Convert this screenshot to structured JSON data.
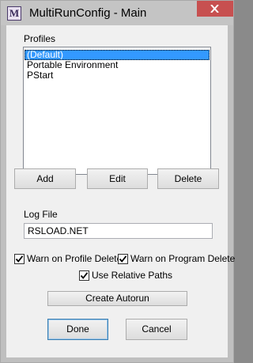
{
  "window": {
    "title": "MultiRunConfig - Main",
    "app_icon_glyph": "M"
  },
  "profiles": {
    "label": "Profiles",
    "items": [
      "(Default)",
      "Portable Environment",
      "PStart"
    ],
    "selected_index": 0
  },
  "buttons": {
    "add": "Add",
    "edit": "Edit",
    "delete": "Delete",
    "create_autorun": "Create Autorun",
    "done": "Done",
    "cancel": "Cancel"
  },
  "log_file": {
    "label": "Log File",
    "value": "RSLOAD.NET"
  },
  "options": {
    "warn_profile_delete": {
      "label": "Warn on Profile Delete",
      "checked": true
    },
    "warn_program_delete": {
      "label": "Warn on Program Delete",
      "checked": true
    },
    "use_relative_paths": {
      "label": "Use Relative Paths",
      "checked": true
    }
  },
  "colors": {
    "selection": "#3399ff",
    "close_button": "#c75050"
  }
}
